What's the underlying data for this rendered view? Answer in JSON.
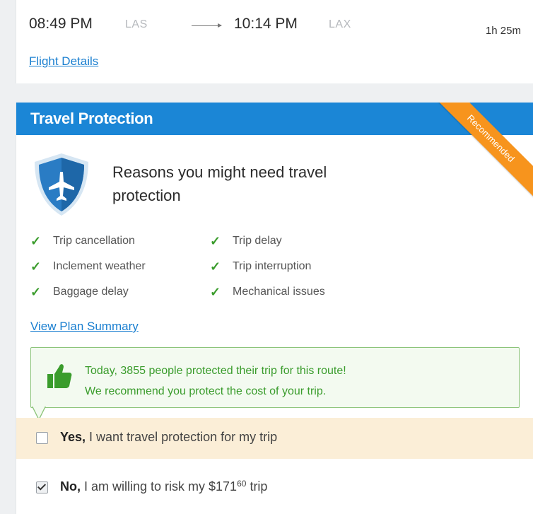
{
  "flight": {
    "depart_time": "08:49 PM",
    "depart_code": "LAS",
    "arrive_time": "10:14 PM",
    "arrive_code": "LAX",
    "duration": "1h 25m",
    "details_link": "Flight Details"
  },
  "protection": {
    "title": "Travel Protection",
    "badge": "Recommended",
    "reasons_heading": "Reasons you might need travel protection",
    "features": [
      "Trip cancellation",
      "Trip delay",
      "Inclement weather",
      "Trip interruption",
      "Baggage delay",
      "Mechanical issues"
    ],
    "plan_summary_link": "View Plan Summary",
    "recommend_line1": "Today, 3855 people protected their trip for this route!",
    "recommend_line2": "We recommend you protect the cost of your trip.",
    "yes_bold": "Yes,",
    "yes_text": " I want travel protection for my trip",
    "yes_checked": false,
    "no_bold": "No,",
    "no_text": " I am willing to risk my $171",
    "no_cents": "60",
    "no_suffix": " trip",
    "no_checked": true
  },
  "colors": {
    "header_blue": "#1b86d6",
    "ribbon_orange": "#f7941d",
    "check_green": "#3a9c2c",
    "yes_bg": "#fbeed7"
  },
  "icons": {
    "shield": "shield-plane-icon",
    "check": "checkmark-icon",
    "thumb": "thumbs-up-icon"
  }
}
